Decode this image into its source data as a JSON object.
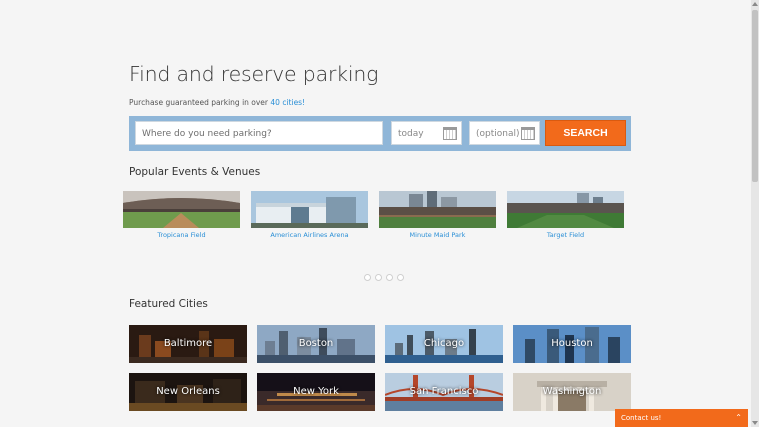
{
  "hero": {
    "title": "Find and reserve parking",
    "subtitle_prefix": "Purchase guaranteed parking in over ",
    "subtitle_link": "40 cities!"
  },
  "search": {
    "where_placeholder": "Where do you need parking?",
    "start_value": "today",
    "end_placeholder": "(optional)",
    "button_label": "SEARCH"
  },
  "popular": {
    "heading": "Popular Events & Venues",
    "venues": [
      {
        "label": "Tropicana Field"
      },
      {
        "label": "American Airlines Arena"
      },
      {
        "label": "Minute Maid Park"
      },
      {
        "label": "Target Field"
      }
    ]
  },
  "featured": {
    "heading": "Featured Cities",
    "cities": [
      {
        "name": "Baltimore"
      },
      {
        "name": "Boston"
      },
      {
        "name": "Chicago"
      },
      {
        "name": "Houston"
      },
      {
        "name": "New Orleans"
      },
      {
        "name": "New York"
      },
      {
        "name": "San Francisco"
      },
      {
        "name": "Washington"
      }
    ]
  },
  "contact": {
    "label": "Contact us!"
  },
  "colors": {
    "accent": "#f26a1b",
    "link": "#2a8fd6",
    "search_band": "#8fb6d8"
  }
}
